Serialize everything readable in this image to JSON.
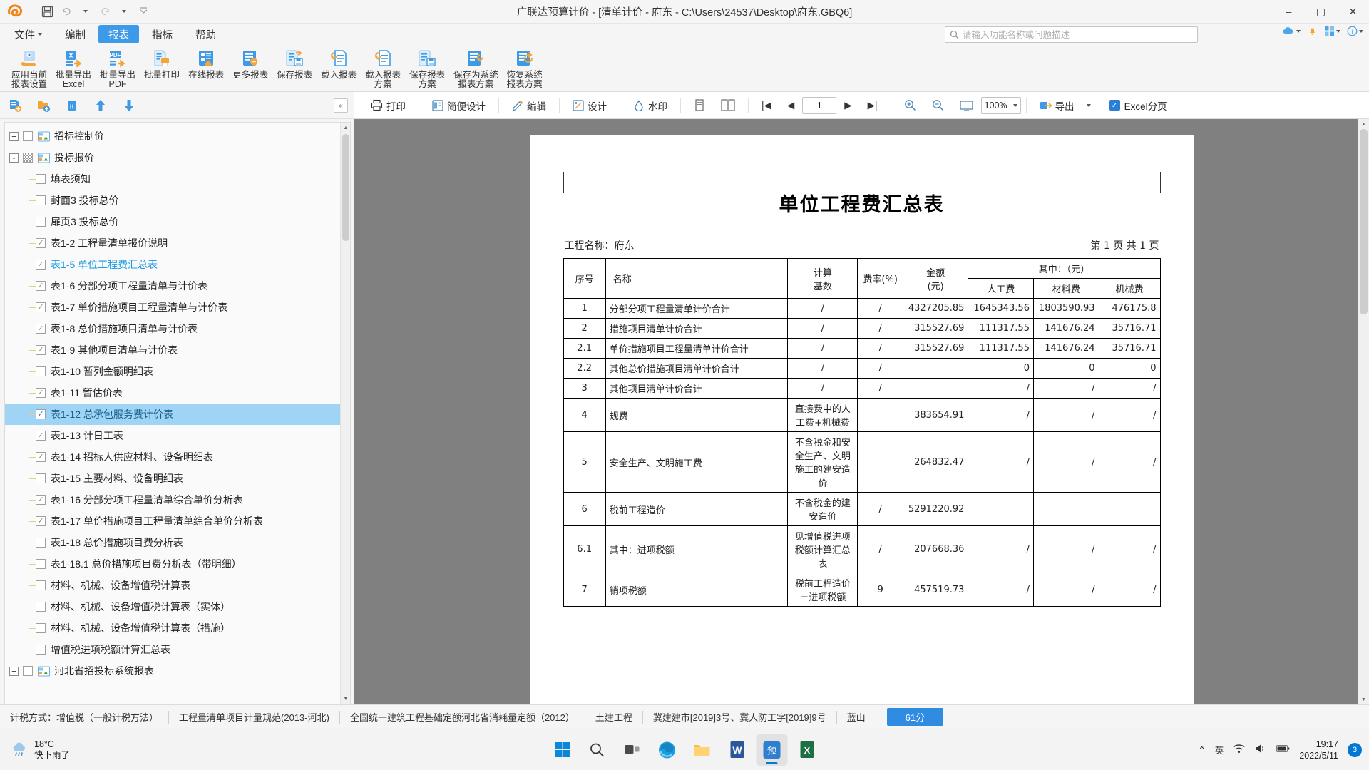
{
  "window": {
    "title": "广联达预算计价 - [清单计价 - 府东 - C:\\Users\\24537\\Desktop\\府东.GBQ6]",
    "minimize": "–",
    "maximize": "▢",
    "close": "✕"
  },
  "quick_access": {
    "save": "save-icon",
    "undo": "undo-icon",
    "redo": "redo-icon",
    "more": "more-icon"
  },
  "menu": {
    "items": [
      {
        "label": "文件",
        "has_caret": true,
        "active": false
      },
      {
        "label": "编制",
        "has_caret": false,
        "active": false
      },
      {
        "label": "报表",
        "has_caret": false,
        "active": true
      },
      {
        "label": "指标",
        "has_caret": false,
        "active": false
      },
      {
        "label": "帮助",
        "has_caret": false,
        "active": false
      }
    ]
  },
  "search": {
    "placeholder": "请输入功能名称或问题描述",
    "value": ""
  },
  "ribbon": {
    "items": [
      {
        "label": "应用当前\n报表设置",
        "icon": "apply-current-icon"
      },
      {
        "label": "批量导出\nExcel",
        "icon": "export-excel-icon"
      },
      {
        "label": "批量导出\nPDF",
        "icon": "export-pdf-icon"
      },
      {
        "label": "批量打印",
        "icon": "batch-print-icon"
      },
      {
        "label": "在线报表",
        "icon": "online-report-icon"
      },
      {
        "label": "更多报表",
        "icon": "more-report-icon"
      },
      {
        "label": "保存报表",
        "icon": "save-report-icon"
      },
      {
        "label": "载入报表",
        "icon": "load-report-icon"
      },
      {
        "label": "载入报表\n方案",
        "icon": "load-report-plan-icon"
      },
      {
        "label": "保存报表\n方案",
        "icon": "save-report-plan-icon"
      },
      {
        "label": "保存为系统\n报表方案",
        "icon": "save-system-plan-icon"
      },
      {
        "label": "恢复系统\n报表方案",
        "icon": "restore-system-plan-icon"
      }
    ]
  },
  "left_panel": {
    "tools": [
      "add-report-icon",
      "add-folder-icon",
      "delete-icon",
      "move-up-icon",
      "move-down-icon"
    ],
    "collapse_label": "«",
    "tree": [
      {
        "level": 0,
        "expander": "+",
        "check": "unchecked",
        "report_icon": true,
        "label": "招标控制价",
        "style": "normal"
      },
      {
        "level": 0,
        "expander": "-",
        "check": "partial",
        "report_icon": true,
        "label": "投标报价",
        "style": "normal"
      },
      {
        "level": 1,
        "expander": "",
        "check": "unchecked",
        "report_icon": false,
        "label": "填表须知",
        "style": "normal"
      },
      {
        "level": 1,
        "expander": "",
        "check": "unchecked",
        "report_icon": false,
        "label": "封面3 投标总价",
        "style": "normal"
      },
      {
        "level": 1,
        "expander": "",
        "check": "unchecked",
        "report_icon": false,
        "label": "扉页3 投标总价",
        "style": "normal"
      },
      {
        "level": 1,
        "expander": "",
        "check": "checked",
        "report_icon": false,
        "label": "表1-2 工程量清单报价说明",
        "style": "normal"
      },
      {
        "level": 1,
        "expander": "",
        "check": "checked",
        "report_icon": false,
        "label": "表1-5 单位工程费汇总表",
        "style": "blue"
      },
      {
        "level": 1,
        "expander": "",
        "check": "checked",
        "report_icon": false,
        "label": "表1-6 分部分项工程量清单与计价表",
        "style": "normal"
      },
      {
        "level": 1,
        "expander": "",
        "check": "checked",
        "report_icon": false,
        "label": "表1-7 单价措施项目工程量清单与计价表",
        "style": "normal"
      },
      {
        "level": 1,
        "expander": "",
        "check": "checked",
        "report_icon": false,
        "label": "表1-8 总价措施项目清单与计价表",
        "style": "normal"
      },
      {
        "level": 1,
        "expander": "",
        "check": "checked",
        "report_icon": false,
        "label": "表1-9 其他项目清单与计价表",
        "style": "normal"
      },
      {
        "level": 1,
        "expander": "",
        "check": "unchecked",
        "report_icon": false,
        "label": "表1-10 暂列金额明细表",
        "style": "normal"
      },
      {
        "level": 1,
        "expander": "",
        "check": "checked",
        "report_icon": false,
        "label": "表1-11 暂估价表",
        "style": "normal"
      },
      {
        "level": 1,
        "expander": "",
        "check": "checked-dark",
        "report_icon": false,
        "label": "表1-12 总承包服务费计价表",
        "style": "selected",
        "selected": true
      },
      {
        "level": 1,
        "expander": "",
        "check": "checked",
        "report_icon": false,
        "label": "表1-13 计日工表",
        "style": "normal"
      },
      {
        "level": 1,
        "expander": "",
        "check": "checked",
        "report_icon": false,
        "label": "表1-14 招标人供应材料、设备明细表",
        "style": "normal"
      },
      {
        "level": 1,
        "expander": "",
        "check": "unchecked",
        "report_icon": false,
        "label": "表1-15 主要材料、设备明细表",
        "style": "normal"
      },
      {
        "level": 1,
        "expander": "",
        "check": "checked",
        "report_icon": false,
        "label": "表1-16 分部分项工程量清单综合单价分析表",
        "style": "normal"
      },
      {
        "level": 1,
        "expander": "",
        "check": "checked",
        "report_icon": false,
        "label": "表1-17 单价措施项目工程量清单综合单价分析表",
        "style": "normal"
      },
      {
        "level": 1,
        "expander": "",
        "check": "unchecked",
        "report_icon": false,
        "label": "表1-18 总价措施项目费分析表",
        "style": "normal"
      },
      {
        "level": 1,
        "expander": "",
        "check": "unchecked",
        "report_icon": false,
        "label": "表1-18.1 总价措施项目费分析表（带明细）",
        "style": "normal"
      },
      {
        "level": 1,
        "expander": "",
        "check": "unchecked",
        "report_icon": false,
        "label": "材料、机械、设备增值税计算表",
        "style": "normal"
      },
      {
        "level": 1,
        "expander": "",
        "check": "unchecked",
        "report_icon": false,
        "label": "材料、机械、设备增值税计算表（实体）",
        "style": "normal"
      },
      {
        "level": 1,
        "expander": "",
        "check": "unchecked",
        "report_icon": false,
        "label": "材料、机械、设备增值税计算表（措施）",
        "style": "normal"
      },
      {
        "level": 1,
        "expander": "",
        "check": "unchecked",
        "report_icon": false,
        "label": "增值税进项税额计算汇总表",
        "style": "normal"
      },
      {
        "level": 0,
        "expander": "+",
        "check": "unchecked",
        "report_icon": true,
        "label": "河北省招投标系统报表",
        "style": "normal"
      }
    ]
  },
  "preview_toolbar": {
    "print": "打印",
    "simple_design": "简便设计",
    "edit": "编辑",
    "design": "设计",
    "watermark": "水印",
    "page_first": "|◀",
    "page_prev": "◀",
    "page_next": "▶",
    "page_last": "▶|",
    "page_value": "1",
    "zoom_value": "100%",
    "export": "导出",
    "excel_paging": "Excel分页",
    "excel_paging_checked": true
  },
  "document": {
    "title": "单位工程费汇总表",
    "project_label": "工程名称：府东",
    "page_label": "第 1 页  共 1 页",
    "headers": {
      "seq": "序号",
      "name": "名称",
      "basis": "计算\n基数",
      "rate": "费率(%)",
      "amount": "金额\n(元)",
      "group": "其中：（元）",
      "labor": "人工费",
      "material": "材料费",
      "machine": "机械费"
    },
    "rows": [
      {
        "seq": "1",
        "name": "分部分项工程量清单计价合计",
        "basis": "/",
        "rate": "/",
        "amount": "4327205.85",
        "labor": "1645343.56",
        "material": "1803590.93",
        "machine": "476175.8"
      },
      {
        "seq": "2",
        "name": "措施项目清单计价合计",
        "basis": "/",
        "rate": "/",
        "amount": "315527.69",
        "labor": "111317.55",
        "material": "141676.24",
        "machine": "35716.71"
      },
      {
        "seq": "2.1",
        "name": "单价措施项目工程量清单计价合计",
        "basis": "/",
        "rate": "/",
        "amount": "315527.69",
        "labor": "111317.55",
        "material": "141676.24",
        "machine": "35716.71"
      },
      {
        "seq": "2.2",
        "name": "其他总价措施项目清单计价合计",
        "basis": "/",
        "rate": "/",
        "amount": "",
        "labor": "0",
        "material": "0",
        "machine": "0"
      },
      {
        "seq": "3",
        "name": "其他项目清单计价合计",
        "basis": "/",
        "rate": "/",
        "amount": "",
        "labor": "/",
        "material": "/",
        "machine": "/"
      },
      {
        "seq": "4",
        "name": "规费",
        "basis": "直接费中的人工费+机械费",
        "rate": "",
        "amount": "383654.91",
        "labor": "/",
        "material": "/",
        "machine": "/"
      },
      {
        "seq": "5",
        "name": "安全生产、文明施工费",
        "basis": "不含税金和安全生产、文明施工的建安造价",
        "rate": "",
        "amount": "264832.47",
        "labor": "/",
        "material": "/",
        "machine": "/"
      },
      {
        "seq": "6",
        "name": "税前工程造价",
        "basis": "不含税金的建安造价",
        "rate": "/",
        "amount": "5291220.92",
        "labor": "",
        "material": "",
        "machine": ""
      },
      {
        "seq": "6.1",
        "name": "其中：进项税额",
        "basis": "见增值税进项税额计算汇总表",
        "rate": "/",
        "amount": "207668.36",
        "labor": "/",
        "material": "/",
        "machine": "/"
      },
      {
        "seq": "7",
        "name": "销项税额",
        "basis": "税前工程造价－进项税额",
        "rate": "9",
        "amount": "457519.73",
        "labor": "/",
        "material": "/",
        "machine": "/"
      }
    ]
  },
  "statusbar": {
    "tax_method": "计税方式：增值税（一般计税方法）",
    "standard": "工程量清单项目计量规范(2013-河北)",
    "quota": "全国统一建筑工程基础定额河北省消耗量定额（2012）",
    "project_type": "土建工程",
    "documents": "冀建建市[2019]3号、冀人防工字[2019]9号",
    "region": "蓝山",
    "badge": "61分"
  },
  "taskbar": {
    "weather_temp": "18°C",
    "weather_desc": "快下雨了",
    "apps": [
      {
        "name": "start-button",
        "icon": "windows-logo"
      },
      {
        "name": "search-button",
        "icon": "magnifier"
      },
      {
        "name": "task-view-button",
        "icon": "task-view"
      },
      {
        "name": "edge-app",
        "icon": "edge"
      },
      {
        "name": "file-explorer-app",
        "icon": "folder"
      },
      {
        "name": "word-app",
        "icon": "word"
      },
      {
        "name": "preview-app",
        "icon": "preview",
        "label": "预",
        "active": true
      },
      {
        "name": "excel-app",
        "icon": "excel"
      }
    ],
    "tray": {
      "ime": "英",
      "time": "19:17",
      "date": "2022/5/11",
      "notification_count": "3"
    }
  }
}
